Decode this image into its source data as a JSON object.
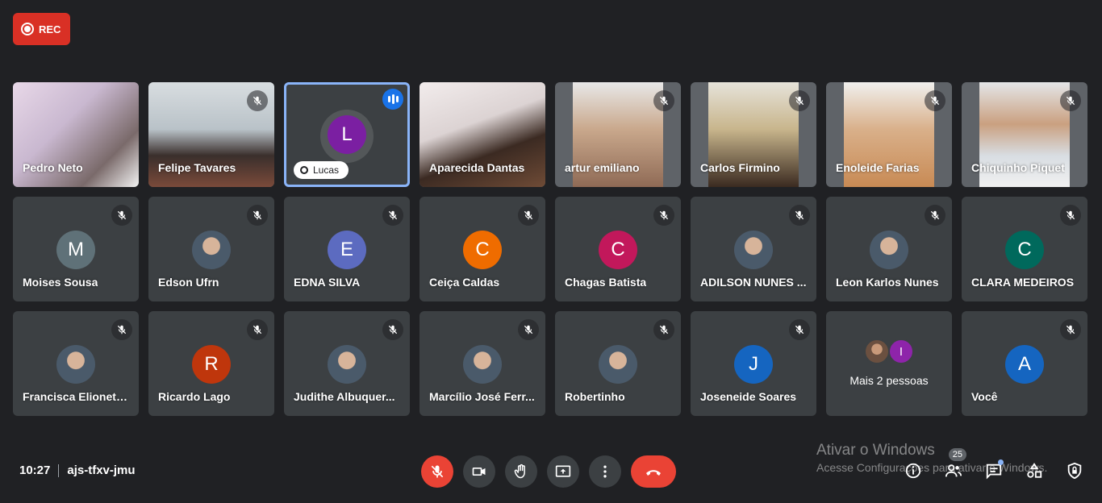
{
  "rec": {
    "label": "REC",
    "color": "#d93025"
  },
  "participants": [
    {
      "name": "Pedro Neto",
      "kind": "video"
    },
    {
      "name": "Felipe Tavares",
      "kind": "video",
      "muted": true
    },
    {
      "name": "Lucas",
      "initial": "L",
      "kind": "pinned",
      "color": "#7b1fa2",
      "speaking": true
    },
    {
      "name": "Aparecida Dantas",
      "kind": "video"
    },
    {
      "name": "artur emiliano",
      "kind": "video",
      "muted": true
    },
    {
      "name": "Carlos Firmino",
      "kind": "video",
      "muted": true
    },
    {
      "name": "Enoleide Farias",
      "kind": "video",
      "muted": true
    },
    {
      "name": "Chiquinho Piquet",
      "kind": "video",
      "muted": true
    },
    {
      "name": "Moises Sousa",
      "initial": "M",
      "color": "#5f7178",
      "muted": true
    },
    {
      "name": "Edson Ufrn",
      "photo": true,
      "muted": true
    },
    {
      "name": "EDNA SILVA",
      "initial": "E",
      "color": "#5c6bc0",
      "muted": true
    },
    {
      "name": "Ceiça Caldas",
      "initial": "C",
      "color": "#ef6c00",
      "muted": true
    },
    {
      "name": "Chagas Batista",
      "initial": "C",
      "color": "#c2185b",
      "muted": true
    },
    {
      "name": "ADILSON NUNES ...",
      "photo": true,
      "muted": true
    },
    {
      "name": "Leon Karlos Nunes",
      "photo": true,
      "muted": true
    },
    {
      "name": "CLARA MEDEIROS",
      "initial": "C",
      "color": "#00695c",
      "muted": true
    },
    {
      "name": "Francisca Elionete...",
      "photo": true,
      "muted": true
    },
    {
      "name": "Ricardo Lago",
      "initial": "R",
      "color": "#bf360c",
      "muted": true
    },
    {
      "name": "Judithe Albuquer...",
      "photo": true,
      "muted": true
    },
    {
      "name": "Marcílio José Ferr...",
      "photo": true,
      "muted": true
    },
    {
      "name": "Robertinho",
      "photo": true,
      "muted": true
    },
    {
      "name": "Joseneide Soares",
      "initial": "J",
      "color": "#1565c0",
      "muted": true
    },
    {
      "name": "Mais 2 pessoas",
      "kind": "more",
      "extra_initial": "I",
      "extra_color": "#8e24aa"
    },
    {
      "name": "Você",
      "initial": "A",
      "color": "#1565c0",
      "muted": true
    }
  ],
  "meeting": {
    "time": "10:27",
    "code": "ajs-tfxv-jmu"
  },
  "people_count": "25",
  "watermark": {
    "line1": "Ativar o Windows",
    "line2": "Acesse Configurações para ativar o Windows."
  }
}
